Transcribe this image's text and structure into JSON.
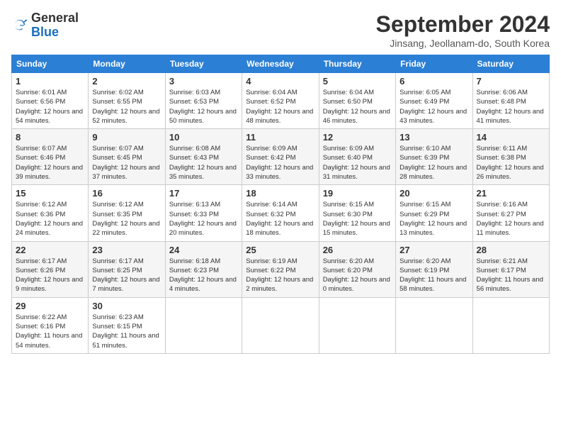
{
  "header": {
    "logo_general": "General",
    "logo_blue": "Blue",
    "month_year": "September 2024",
    "location": "Jinsang, Jeollanam-do, South Korea"
  },
  "weekdays": [
    "Sunday",
    "Monday",
    "Tuesday",
    "Wednesday",
    "Thursday",
    "Friday",
    "Saturday"
  ],
  "weeks": [
    [
      {
        "day": "1",
        "sunrise": "6:01 AM",
        "sunset": "6:56 PM",
        "daylight": "12 hours and 54 minutes."
      },
      {
        "day": "2",
        "sunrise": "6:02 AM",
        "sunset": "6:55 PM",
        "daylight": "12 hours and 52 minutes."
      },
      {
        "day": "3",
        "sunrise": "6:03 AM",
        "sunset": "6:53 PM",
        "daylight": "12 hours and 50 minutes."
      },
      {
        "day": "4",
        "sunrise": "6:04 AM",
        "sunset": "6:52 PM",
        "daylight": "12 hours and 48 minutes."
      },
      {
        "day": "5",
        "sunrise": "6:04 AM",
        "sunset": "6:50 PM",
        "daylight": "12 hours and 46 minutes."
      },
      {
        "day": "6",
        "sunrise": "6:05 AM",
        "sunset": "6:49 PM",
        "daylight": "12 hours and 43 minutes."
      },
      {
        "day": "7",
        "sunrise": "6:06 AM",
        "sunset": "6:48 PM",
        "daylight": "12 hours and 41 minutes."
      }
    ],
    [
      {
        "day": "8",
        "sunrise": "6:07 AM",
        "sunset": "6:46 PM",
        "daylight": "12 hours and 39 minutes."
      },
      {
        "day": "9",
        "sunrise": "6:07 AM",
        "sunset": "6:45 PM",
        "daylight": "12 hours and 37 minutes."
      },
      {
        "day": "10",
        "sunrise": "6:08 AM",
        "sunset": "6:43 PM",
        "daylight": "12 hours and 35 minutes."
      },
      {
        "day": "11",
        "sunrise": "6:09 AM",
        "sunset": "6:42 PM",
        "daylight": "12 hours and 33 minutes."
      },
      {
        "day": "12",
        "sunrise": "6:09 AM",
        "sunset": "6:40 PM",
        "daylight": "12 hours and 31 minutes."
      },
      {
        "day": "13",
        "sunrise": "6:10 AM",
        "sunset": "6:39 PM",
        "daylight": "12 hours and 28 minutes."
      },
      {
        "day": "14",
        "sunrise": "6:11 AM",
        "sunset": "6:38 PM",
        "daylight": "12 hours and 26 minutes."
      }
    ],
    [
      {
        "day": "15",
        "sunrise": "6:12 AM",
        "sunset": "6:36 PM",
        "daylight": "12 hours and 24 minutes."
      },
      {
        "day": "16",
        "sunrise": "6:12 AM",
        "sunset": "6:35 PM",
        "daylight": "12 hours and 22 minutes."
      },
      {
        "day": "17",
        "sunrise": "6:13 AM",
        "sunset": "6:33 PM",
        "daylight": "12 hours and 20 minutes."
      },
      {
        "day": "18",
        "sunrise": "6:14 AM",
        "sunset": "6:32 PM",
        "daylight": "12 hours and 18 minutes."
      },
      {
        "day": "19",
        "sunrise": "6:15 AM",
        "sunset": "6:30 PM",
        "daylight": "12 hours and 15 minutes."
      },
      {
        "day": "20",
        "sunrise": "6:15 AM",
        "sunset": "6:29 PM",
        "daylight": "12 hours and 13 minutes."
      },
      {
        "day": "21",
        "sunrise": "6:16 AM",
        "sunset": "6:27 PM",
        "daylight": "12 hours and 11 minutes."
      }
    ],
    [
      {
        "day": "22",
        "sunrise": "6:17 AM",
        "sunset": "6:26 PM",
        "daylight": "12 hours and 9 minutes."
      },
      {
        "day": "23",
        "sunrise": "6:17 AM",
        "sunset": "6:25 PM",
        "daylight": "12 hours and 7 minutes."
      },
      {
        "day": "24",
        "sunrise": "6:18 AM",
        "sunset": "6:23 PM",
        "daylight": "12 hours and 4 minutes."
      },
      {
        "day": "25",
        "sunrise": "6:19 AM",
        "sunset": "6:22 PM",
        "daylight": "12 hours and 2 minutes."
      },
      {
        "day": "26",
        "sunrise": "6:20 AM",
        "sunset": "6:20 PM",
        "daylight": "12 hours and 0 minutes."
      },
      {
        "day": "27",
        "sunrise": "6:20 AM",
        "sunset": "6:19 PM",
        "daylight": "11 hours and 58 minutes."
      },
      {
        "day": "28",
        "sunrise": "6:21 AM",
        "sunset": "6:17 PM",
        "daylight": "11 hours and 56 minutes."
      }
    ],
    [
      {
        "day": "29",
        "sunrise": "6:22 AM",
        "sunset": "6:16 PM",
        "daylight": "11 hours and 54 minutes."
      },
      {
        "day": "30",
        "sunrise": "6:23 AM",
        "sunset": "6:15 PM",
        "daylight": "11 hours and 51 minutes."
      },
      null,
      null,
      null,
      null,
      null
    ]
  ]
}
